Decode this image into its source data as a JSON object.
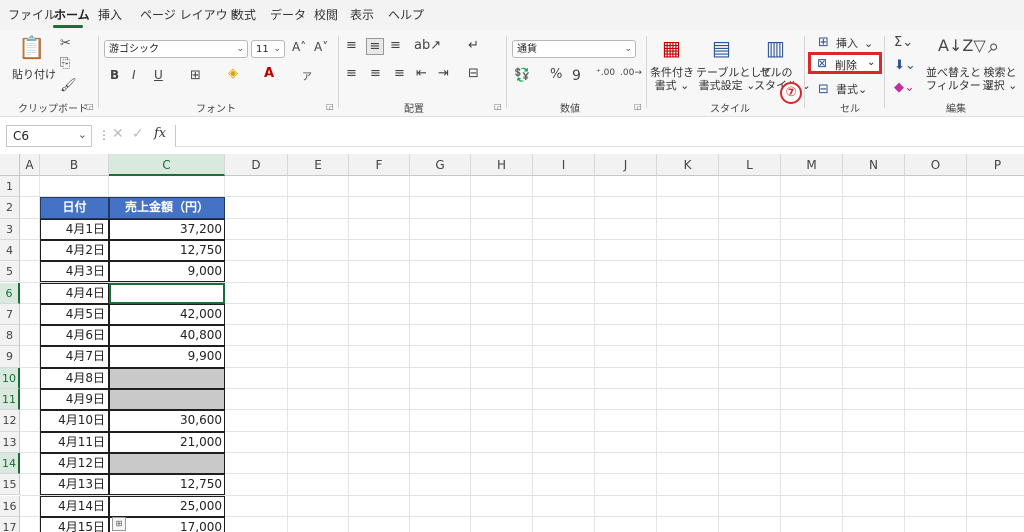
{
  "menu": [
    "ファイル",
    "ホーム",
    "挿入",
    "ページ レイアウト",
    "数式",
    "データ",
    "校閲",
    "表示",
    "ヘルプ"
  ],
  "ribbon": {
    "clipboard": {
      "paste": "貼り付け",
      "label": "クリップボード"
    },
    "font": {
      "name": "游ゴシック",
      "size": "11",
      "label": "フォント"
    },
    "alignment": {
      "label": "配置"
    },
    "number": {
      "format": "通貨",
      "label": "数値"
    },
    "styles": {
      "conditional": "条件付き\n書式 ⌄",
      "table": "テーブルとして\n書式設定 ⌄",
      "cell": "セルの\nスタイル ⌄",
      "label": "スタイル"
    },
    "cells": {
      "insert": "挿入",
      "delete": "削除",
      "format": "書式",
      "label": "セル"
    },
    "editing": {
      "sort": "並べ替えと\nフィルター ⌄",
      "find": "検索と\n選択 ⌄",
      "label": "編集"
    }
  },
  "annotation_number": "⑦",
  "namebox": "C6",
  "columns": [
    "A",
    "B",
    "C",
    "D",
    "E",
    "F",
    "G",
    "H",
    "I",
    "J",
    "K",
    "L",
    "M",
    "N",
    "O",
    "P"
  ],
  "rows": [
    "1",
    "2",
    "3",
    "4",
    "5",
    "6",
    "7",
    "8",
    "9",
    "10",
    "11",
    "12",
    "13",
    "14",
    "15",
    "16",
    "17"
  ],
  "table": {
    "headers": [
      "日付",
      "売上金額（円）"
    ],
    "rows": [
      {
        "date": "4月1日",
        "amount": "37,200"
      },
      {
        "date": "4月2日",
        "amount": "12,750"
      },
      {
        "date": "4月3日",
        "amount": "9,000"
      },
      {
        "date": "4月4日",
        "amount": ""
      },
      {
        "date": "4月5日",
        "amount": "42,000"
      },
      {
        "date": "4月6日",
        "amount": "40,800"
      },
      {
        "date": "4月7日",
        "amount": "9,900"
      },
      {
        "date": "4月8日",
        "amount": ""
      },
      {
        "date": "4月9日",
        "amount": ""
      },
      {
        "date": "4月10日",
        "amount": "30,600"
      },
      {
        "date": "4月11日",
        "amount": "21,000"
      },
      {
        "date": "4月12日",
        "amount": ""
      },
      {
        "date": "4月13日",
        "amount": "12,750"
      },
      {
        "date": "4月14日",
        "amount": "25,000"
      },
      {
        "date": "4月15日",
        "amount": "17,000"
      }
    ]
  }
}
